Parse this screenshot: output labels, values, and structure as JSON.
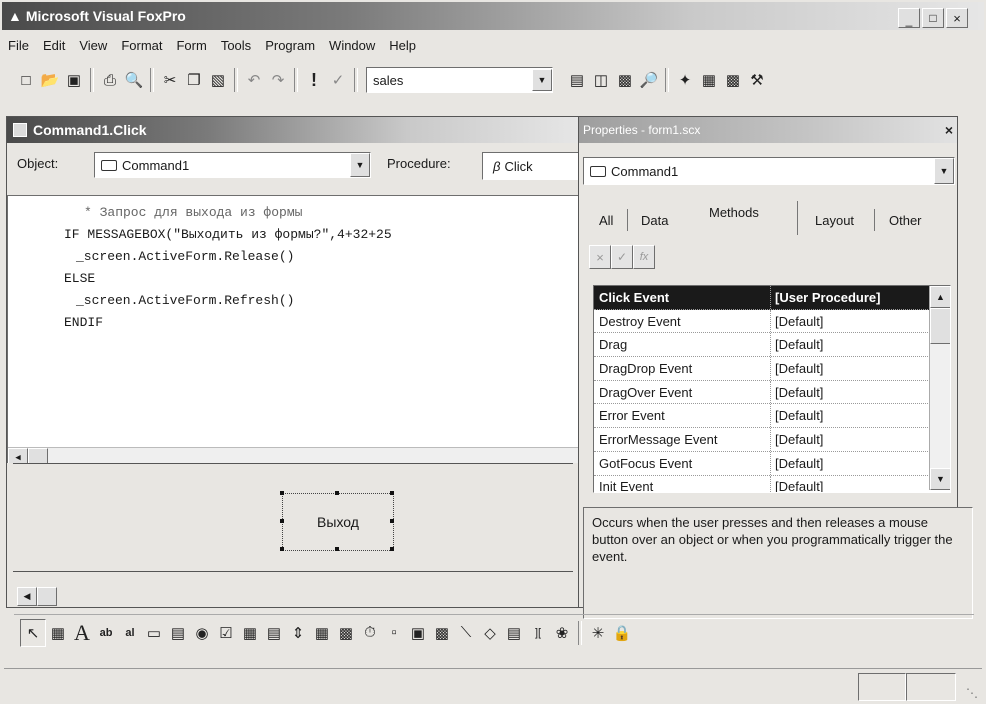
{
  "app": {
    "title": "Microsoft Visual FoxPro",
    "controls": [
      "_",
      "□",
      "×"
    ]
  },
  "menu": [
    "File",
    "Edit",
    "View",
    "Format",
    "Form",
    "Tools",
    "Program",
    "Window",
    "Help"
  ],
  "toolbar": {
    "db_combo_value": "sales"
  },
  "code_window": {
    "title": "Command1.Click",
    "object_label": "Object:",
    "object_value": "Command1",
    "procedure_label": "Procedure:",
    "procedure_value": "Click",
    "lines": [
      "* Запрос для выхода из формы",
      "IF MESSAGEBOX(\"Выходить из формы?\",4+32+25",
      "_screen.ActiveForm.Release()",
      "ELSE",
      "_screen.ActiveForm.Refresh()",
      "ENDIF"
    ]
  },
  "form_designer": {
    "button_caption": "Выход"
  },
  "properties": {
    "title": "Properties - form1.scx",
    "object_value": "Command1",
    "tabs": [
      "All",
      "Data",
      "Methods",
      "Layout",
      "Other"
    ],
    "active_tab": "Methods",
    "rows": [
      {
        "name": "Click Event",
        "value": "[User Procedure]"
      },
      {
        "name": "Destroy Event",
        "value": "[Default]"
      },
      {
        "name": "Drag",
        "value": "[Default]"
      },
      {
        "name": "DragDrop Event",
        "value": "[Default]"
      },
      {
        "name": "DragOver Event",
        "value": "[Default]"
      },
      {
        "name": "Error Event",
        "value": "[Default]"
      },
      {
        "name": "ErrorMessage Event",
        "value": "[Default]"
      },
      {
        "name": "GotFocus Event",
        "value": "[Default]"
      },
      {
        "name": "Init Event",
        "value": "[Default]"
      }
    ],
    "description": "Occurs when the user presses and then releases a mouse button over an object or when you programmatically trigger the event."
  },
  "colors": {
    "selected_row": "#1a1a1a",
    "title_dark": "#4a4a4a"
  }
}
